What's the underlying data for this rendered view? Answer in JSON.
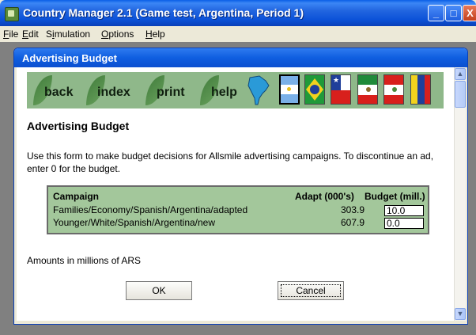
{
  "window": {
    "title": "Country Manager 2.1 (Game test, Argentina, Period 1)",
    "minimize_glyph": "_",
    "maximize_glyph": "□",
    "close_glyph": "X"
  },
  "menu": {
    "items": [
      {
        "prefix": "",
        "hotkey": "F",
        "rest": "ile"
      },
      {
        "prefix": "",
        "hotkey": "E",
        "rest": "dit"
      },
      {
        "prefix": "S",
        "hotkey": "i",
        "rest": "mulation"
      },
      {
        "prefix": "",
        "hotkey": "O",
        "rest": "ptions"
      },
      {
        "prefix": "",
        "hotkey": "H",
        "rest": "elp"
      }
    ]
  },
  "dialog": {
    "title": "Advertising Budget"
  },
  "toolbar": {
    "buttons": [
      "back",
      "index",
      "print",
      "help"
    ],
    "map_icon": "south-america-map-icon",
    "flags": [
      "argentina",
      "brazil",
      "chile",
      "mexico",
      "peru",
      "venezuela"
    ]
  },
  "content": {
    "heading": "Advertising Budget",
    "intro": "Use this form to make budget decisions for Allsmile advertising campaigns.  To discontinue an ad, enter 0 for the budget.",
    "table": {
      "headers": {
        "campaign": "Campaign",
        "adapt": "Adapt (000's)",
        "budget": "Budget (mill.)"
      },
      "rows": [
        {
          "campaign": "Families/Economy/Spanish/Argentina/adapted",
          "adapt": "303.9",
          "budget": "10.0"
        },
        {
          "campaign": "Younger/White/Spanish/Argentina/new",
          "adapt": "607.9",
          "budget": "0.0"
        }
      ]
    },
    "footnote": "Amounts in millions of ARS",
    "ok_label": "OK",
    "cancel_label": "Cancel"
  },
  "colors": {
    "title_blue": "#0b52d8",
    "toolbar_green": "#8fb88a",
    "table_green": "#a3c79b"
  }
}
